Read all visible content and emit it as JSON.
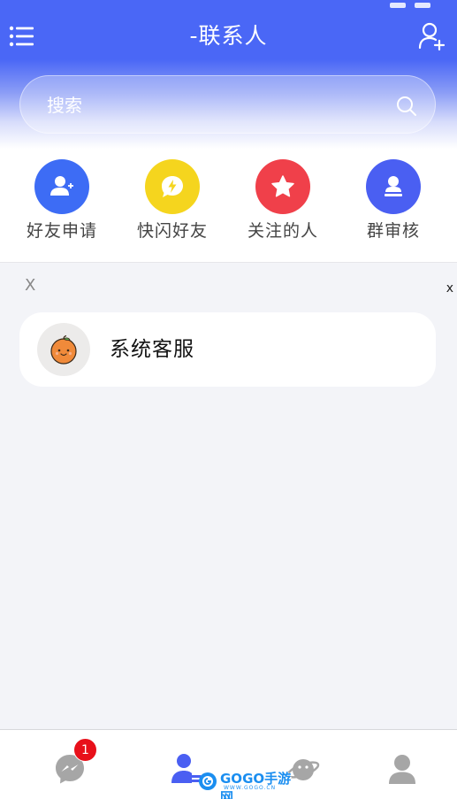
{
  "header": {
    "title": "-联系人"
  },
  "search": {
    "placeholder": "搜索"
  },
  "quick_actions": [
    {
      "label": "好友申请",
      "color": "#3d6cf5",
      "icon": "user-plus-icon"
    },
    {
      "label": "快闪好友",
      "color": "#f5d51e",
      "icon": "flash-chat-icon"
    },
    {
      "label": "关注的人",
      "color": "#f0404a",
      "icon": "star-icon"
    },
    {
      "label": "群审核",
      "color": "#4a5ff2",
      "icon": "group-stamp-icon"
    }
  ],
  "section": {
    "label": "X",
    "close": "x"
  },
  "contacts": [
    {
      "name": "系统客服",
      "avatar": "orange-avatar-icon"
    }
  ],
  "bottom_nav": {
    "items": [
      {
        "name": "messages",
        "icon": "messenger-icon",
        "badge": "1",
        "active": false
      },
      {
        "name": "contacts",
        "icon": "contacts-icon",
        "active": true
      },
      {
        "name": "discover",
        "icon": "planet-icon",
        "active": false
      },
      {
        "name": "profile",
        "icon": "profile-icon",
        "active": false
      }
    ],
    "watermark": "GOGO手游网",
    "watermark_sub": "WWW.GOGO.CN"
  },
  "colors": {
    "primary": "#4a67f6",
    "badge": "#e8101a"
  }
}
